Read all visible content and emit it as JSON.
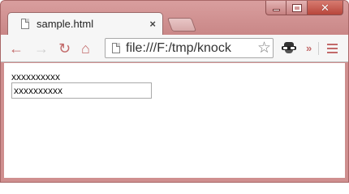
{
  "window": {
    "controls": {
      "minimize": "minimize",
      "maximize": "maximize",
      "close": "close"
    }
  },
  "tabs": [
    {
      "title": "sample.html",
      "icon": "page-icon",
      "active": true
    }
  ],
  "tab_close_glyph": "×",
  "toolbar": {
    "back_glyph": "←",
    "forward_glyph": "→",
    "reload_glyph": "↻",
    "home_glyph": "⌂",
    "url": "file:///F:/tmp/knock",
    "bookmark_glyph": "☆",
    "overflow_glyph": "»",
    "extension_icon": "incognito-spy-icon"
  },
  "page": {
    "text": "xxxxxxxxxx",
    "input_value": "xxxxxxxxxx"
  },
  "colors": {
    "frame": "#cf8f8f",
    "accent": "#c26a6a",
    "toolbar": "#f6f6f6"
  }
}
